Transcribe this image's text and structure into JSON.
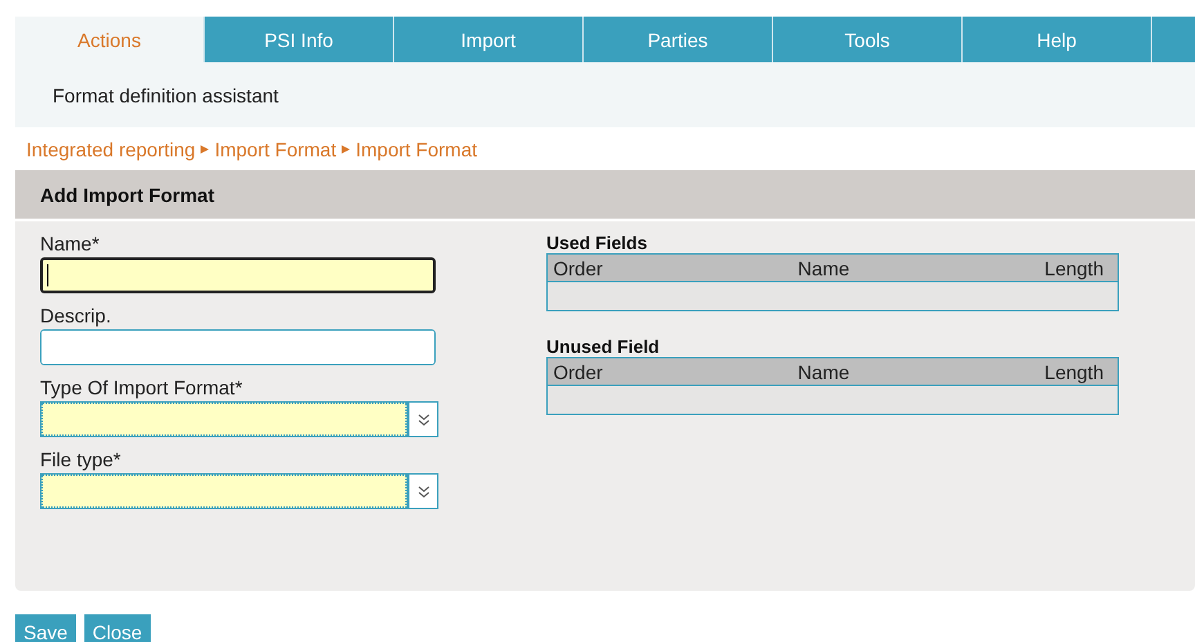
{
  "tabs": [
    {
      "label": "Actions",
      "selected": true
    },
    {
      "label": "PSI Info",
      "selected": false
    },
    {
      "label": "Import",
      "selected": false
    },
    {
      "label": "Parties",
      "selected": false
    },
    {
      "label": "Tools",
      "selected": false
    },
    {
      "label": "Help",
      "selected": false
    }
  ],
  "submenu": {
    "items": [
      "Format definition assistant"
    ]
  },
  "breadcrumb": [
    "Integrated reporting",
    "Import Format",
    "Import Format"
  ],
  "section": {
    "title": "Add Import Format"
  },
  "form_fields": [
    {
      "label": "Name*",
      "kind": "text",
      "required": true,
      "focused": true
    },
    {
      "label": "Descrip.",
      "kind": "text",
      "required": false,
      "focused": false
    },
    {
      "label": "Type Of Import Format*",
      "kind": "select",
      "required": true
    },
    {
      "label": "File type*",
      "kind": "select",
      "required": true
    }
  ],
  "tables": [
    {
      "title": "Used Fields",
      "columns": [
        "Order",
        "Name",
        "Length"
      ]
    },
    {
      "title": "Unused Field",
      "columns": [
        "Order",
        "Name",
        "Length"
      ]
    }
  ],
  "buttons": [
    "Save",
    "Close"
  ]
}
